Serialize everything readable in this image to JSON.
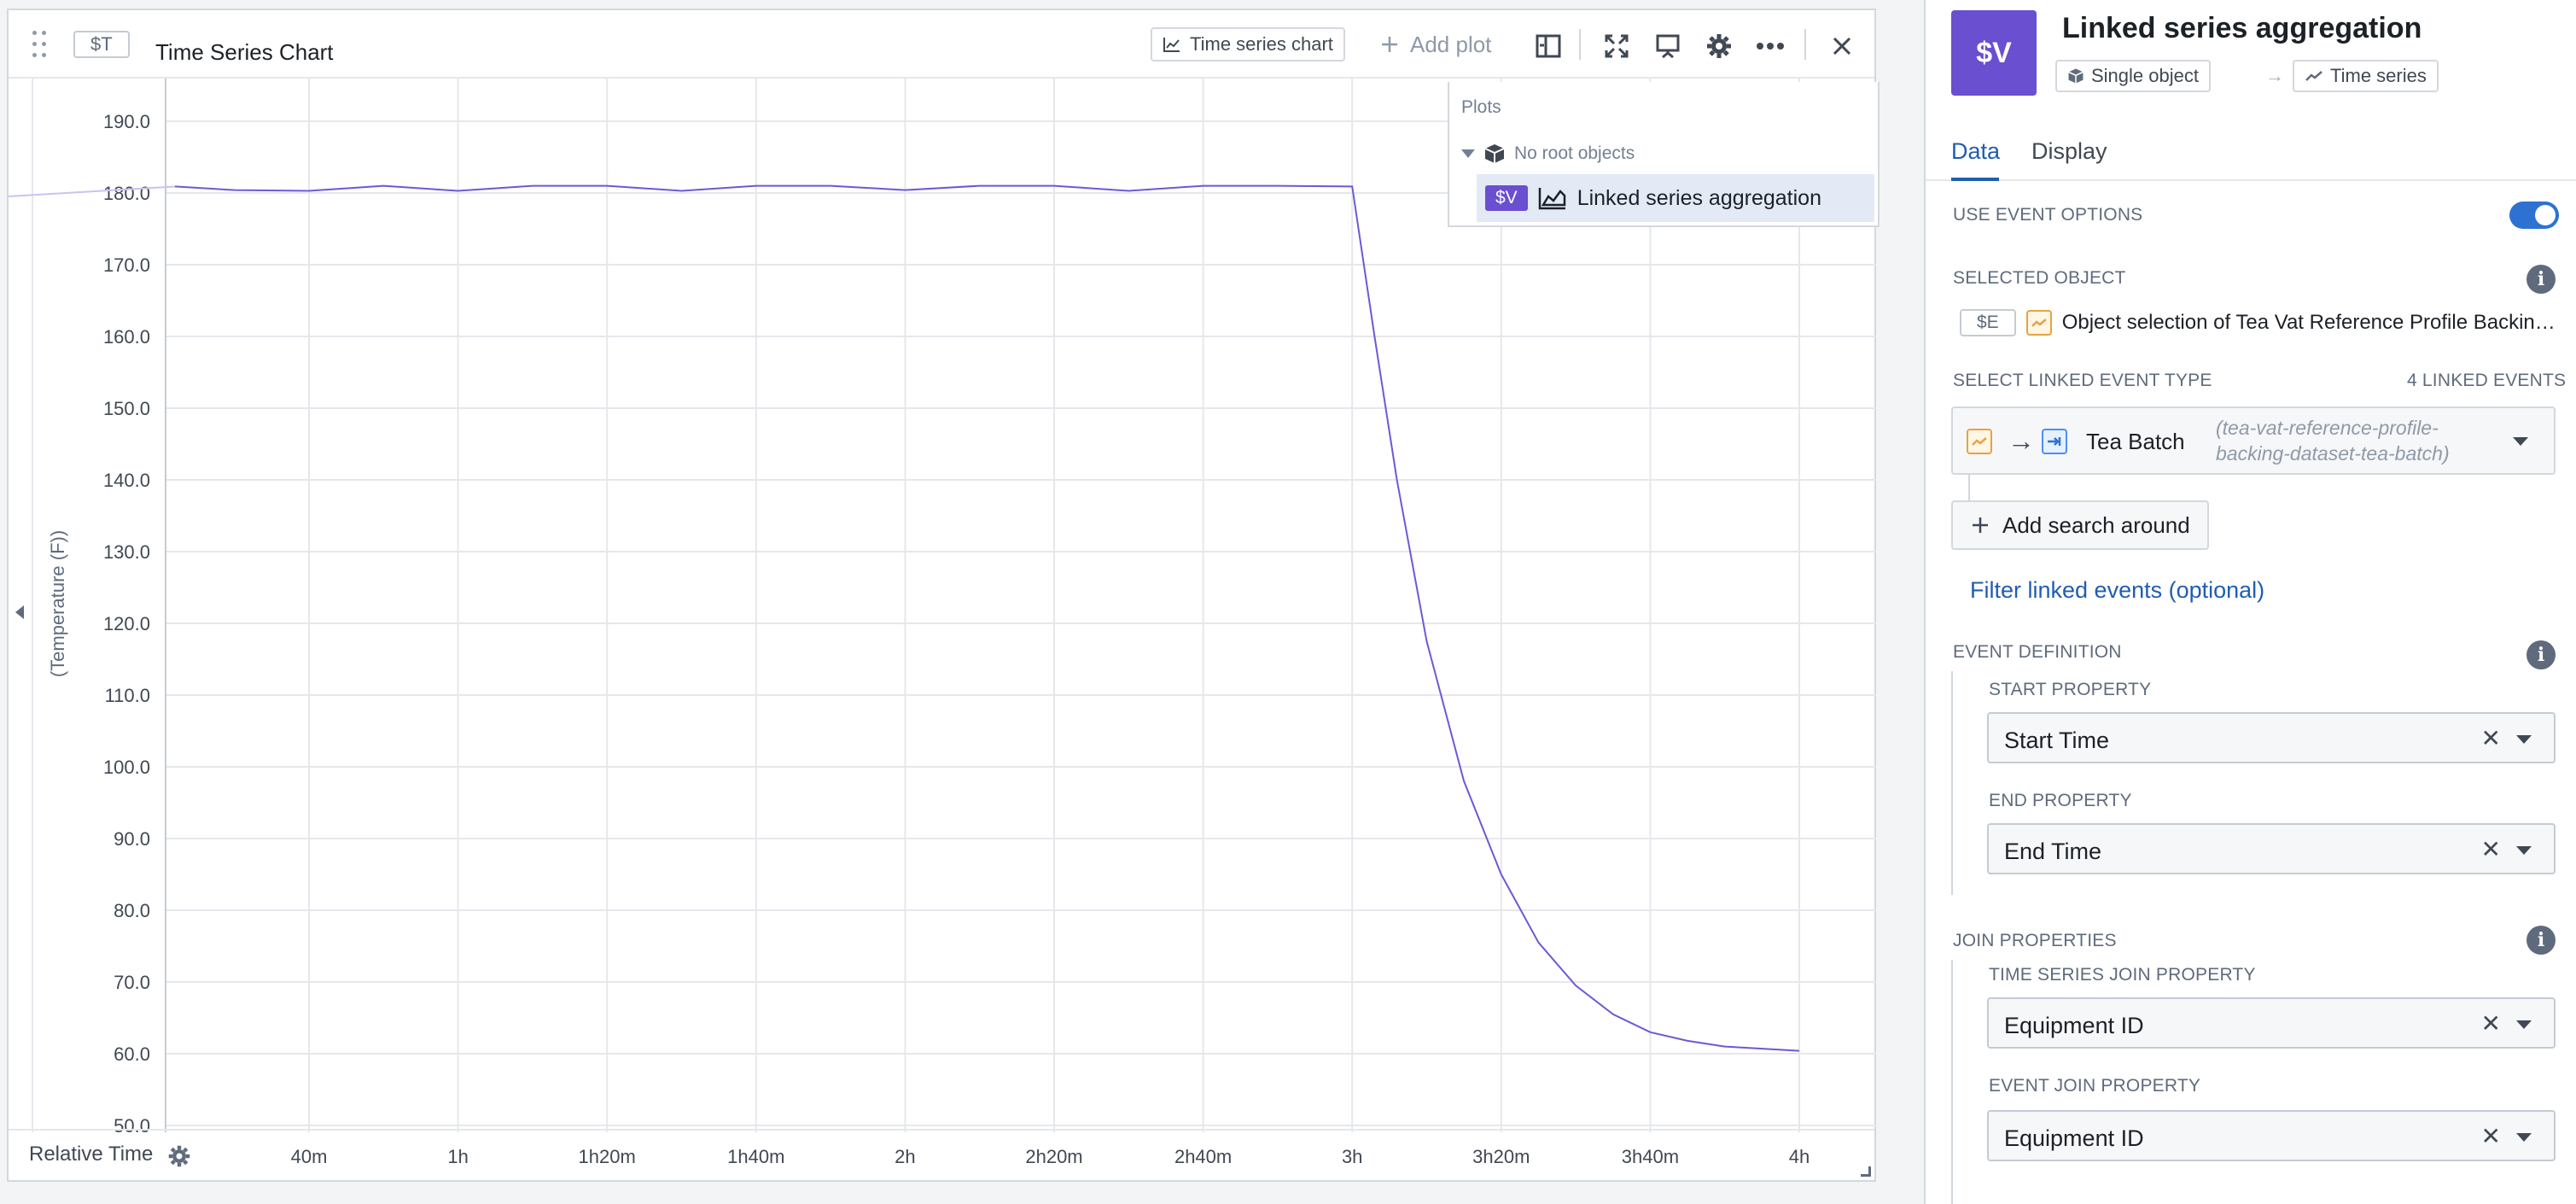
{
  "widget": {
    "var_chip": "$T",
    "title": "Time Series Chart",
    "toolbar": {
      "chart_type_label": "Time series chart",
      "add_plot_label": "Add plot"
    }
  },
  "chart": {
    "y_axis_title": "(Temperature (F))",
    "y_ticks": [
      "190.0",
      "180.0",
      "170.0",
      "160.0",
      "150.0",
      "140.0",
      "130.0",
      "120.0",
      "110.0",
      "100.0",
      "90.0",
      "80.0",
      "70.0",
      "60.0",
      "50.0"
    ],
    "x_ticks": [
      "40m",
      "1h",
      "1h20m",
      "1h40m",
      "2h",
      "2h20m",
      "2h40m",
      "3h",
      "3h20m",
      "3h40m",
      "4h"
    ],
    "x_axis_label": "Relative Time",
    "series_color": "#6a5ad6"
  },
  "chart_data": {
    "type": "line",
    "xlabel": "Relative Time",
    "ylabel": "(Temperature (F))",
    "ylim": [
      50,
      190
    ],
    "x_unit": "minutes",
    "series": [
      {
        "x": [
          22,
          30,
          40,
          50,
          60,
          70,
          80,
          90,
          100,
          110,
          120,
          130,
          140,
          150,
          160,
          170,
          180,
          183,
          186,
          190,
          195,
          200,
          205,
          210,
          215,
          220,
          225,
          230,
          240
        ],
        "y": [
          180.9,
          180.4,
          180.3,
          181.0,
          180.3,
          181.0,
          181.0,
          180.3,
          181.0,
          181.0,
          180.4,
          181.0,
          181.0,
          180.3,
          181.0,
          181.0,
          180.9,
          160.0,
          140.0,
          117.5,
          98.0,
          85.0,
          75.5,
          69.5,
          65.5,
          63.0,
          61.8,
          61.0,
          60.4
        ]
      }
    ]
  },
  "plots_popover": {
    "title": "Plots",
    "root_label": "No root objects",
    "row_var": "$V",
    "row_label": "Linked series aggregation"
  },
  "panel": {
    "avatar": "$V",
    "title": "Linked series aggregation",
    "crumbs": [
      "Single object",
      "Time series"
    ],
    "crumb_arrow": "→",
    "tabs": [
      "Data",
      "Display"
    ],
    "use_event_options": "USE EVENT OPTIONS",
    "selected_object_label": "SELECTED OBJECT",
    "selected_object_var": "$E",
    "selected_object_text": "Object selection of Tea Vat Reference Profile Backing Dataset",
    "linked_event_label": "SELECT LINKED EVENT TYPE",
    "linked_events_count": "4 LINKED EVENTS",
    "event_type_name": "Tea Batch",
    "event_type_api": "(tea-vat-reference-profile-backing-dataset-tea-batch)",
    "add_search_label": "Add search around",
    "filter_link": "Filter linked events (optional)",
    "event_definition_label": "EVENT DEFINITION",
    "start_property_label": "START PROPERTY",
    "start_property_value": "Start Time",
    "end_property_label": "END PROPERTY",
    "end_property_value": "End Time",
    "join_properties_label": "JOIN PROPERTIES",
    "ts_join_label": "TIME SERIES JOIN PROPERTY",
    "ts_join_value": "Equipment ID",
    "event_join_label": "EVENT JOIN PROPERTY",
    "event_join_value": "Equipment ID",
    "toggle_on": true
  },
  "colors": {
    "accent": "#6a4fd1",
    "link": "#215db0",
    "toggle": "#2d72d2"
  }
}
